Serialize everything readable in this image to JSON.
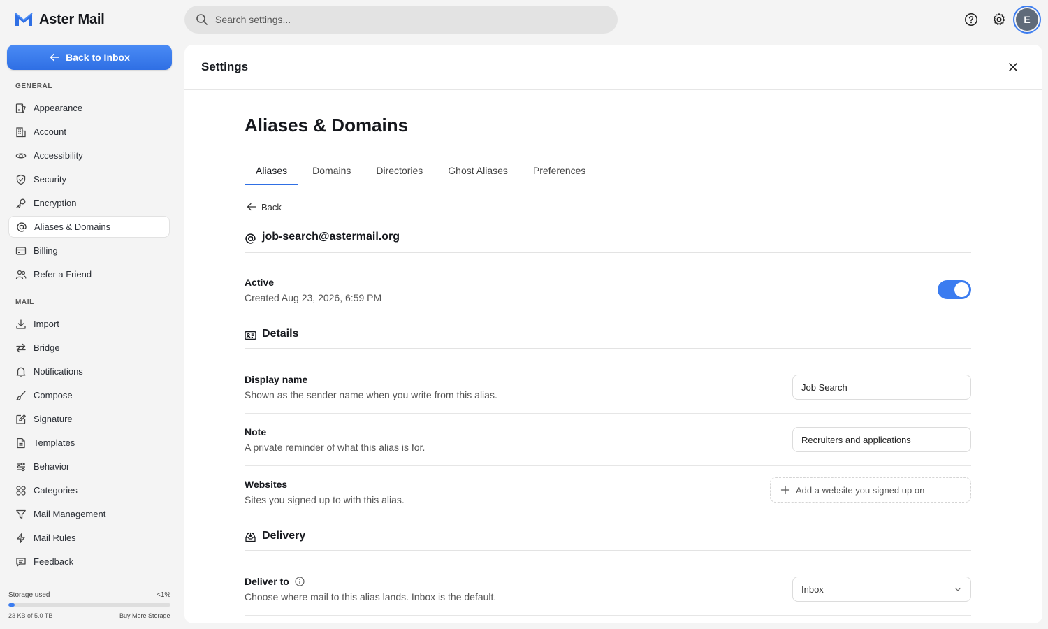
{
  "app": {
    "name": "Aster Mail",
    "search_placeholder": "Search settings...",
    "avatar_initial": "E",
    "accent_color": "#3b7cf0"
  },
  "sidebar": {
    "back_label": "Back to Inbox",
    "general_label": "GENERAL",
    "mail_label": "MAIL",
    "general_items": [
      {
        "label": "Appearance",
        "icon": "appearance-icon"
      },
      {
        "label": "Account",
        "icon": "building-icon"
      },
      {
        "label": "Accessibility",
        "icon": "eye-icon"
      },
      {
        "label": "Security",
        "icon": "shield-icon"
      },
      {
        "label": "Encryption",
        "icon": "key-icon"
      },
      {
        "label": "Aliases & Domains",
        "icon": "at-icon",
        "active": true
      },
      {
        "label": "Billing",
        "icon": "card-icon"
      },
      {
        "label": "Refer a Friend",
        "icon": "users-icon"
      }
    ],
    "mail_items": [
      {
        "label": "Import",
        "icon": "download-icon"
      },
      {
        "label": "Bridge",
        "icon": "arrows-icon"
      },
      {
        "label": "Notifications",
        "icon": "bell-icon"
      },
      {
        "label": "Compose",
        "icon": "brush-icon"
      },
      {
        "label": "Signature",
        "icon": "pen-square-icon"
      },
      {
        "label": "Templates",
        "icon": "file-icon"
      },
      {
        "label": "Behavior",
        "icon": "sliders-icon"
      },
      {
        "label": "Categories",
        "icon": "grid-icon"
      },
      {
        "label": "Mail Management",
        "icon": "filter-icon"
      },
      {
        "label": "Mail Rules",
        "icon": "bolt-icon"
      },
      {
        "label": "Feedback",
        "icon": "message-icon"
      }
    ],
    "storage": {
      "label": "Storage used",
      "percent_text": "<1%",
      "used_fraction": 0.0001,
      "size_text": "23 KB of 5.0 TB",
      "buy_more": "Buy More Storage"
    }
  },
  "panel": {
    "title": "Settings",
    "page_title": "Aliases & Domains",
    "tabs": [
      {
        "label": "Aliases",
        "active": true
      },
      {
        "label": "Domains"
      },
      {
        "label": "Directories"
      },
      {
        "label": "Ghost Aliases"
      },
      {
        "label": "Preferences"
      }
    ],
    "back_label": "Back",
    "alias_address": "job-search@astermail.org",
    "status": {
      "label": "Active",
      "created": "Created Aug 23, 2026, 6:59 PM",
      "enabled": true
    },
    "details": {
      "title": "Details",
      "display_name": {
        "label": "Display name",
        "desc": "Shown as the sender name when you write from this alias.",
        "value": "Job Search"
      },
      "note": {
        "label": "Note",
        "desc": "A private reminder of what this alias is for.",
        "value": "Recruiters and applications"
      },
      "websites": {
        "label": "Websites",
        "desc": "Sites you signed up to with this alias.",
        "add_label": "Add a website you signed up on"
      }
    },
    "delivery": {
      "title": "Delivery",
      "deliver_to": {
        "label": "Deliver to",
        "desc": "Choose where mail to this alias lands. Inbox is the default.",
        "value": "Inbox"
      }
    }
  }
}
